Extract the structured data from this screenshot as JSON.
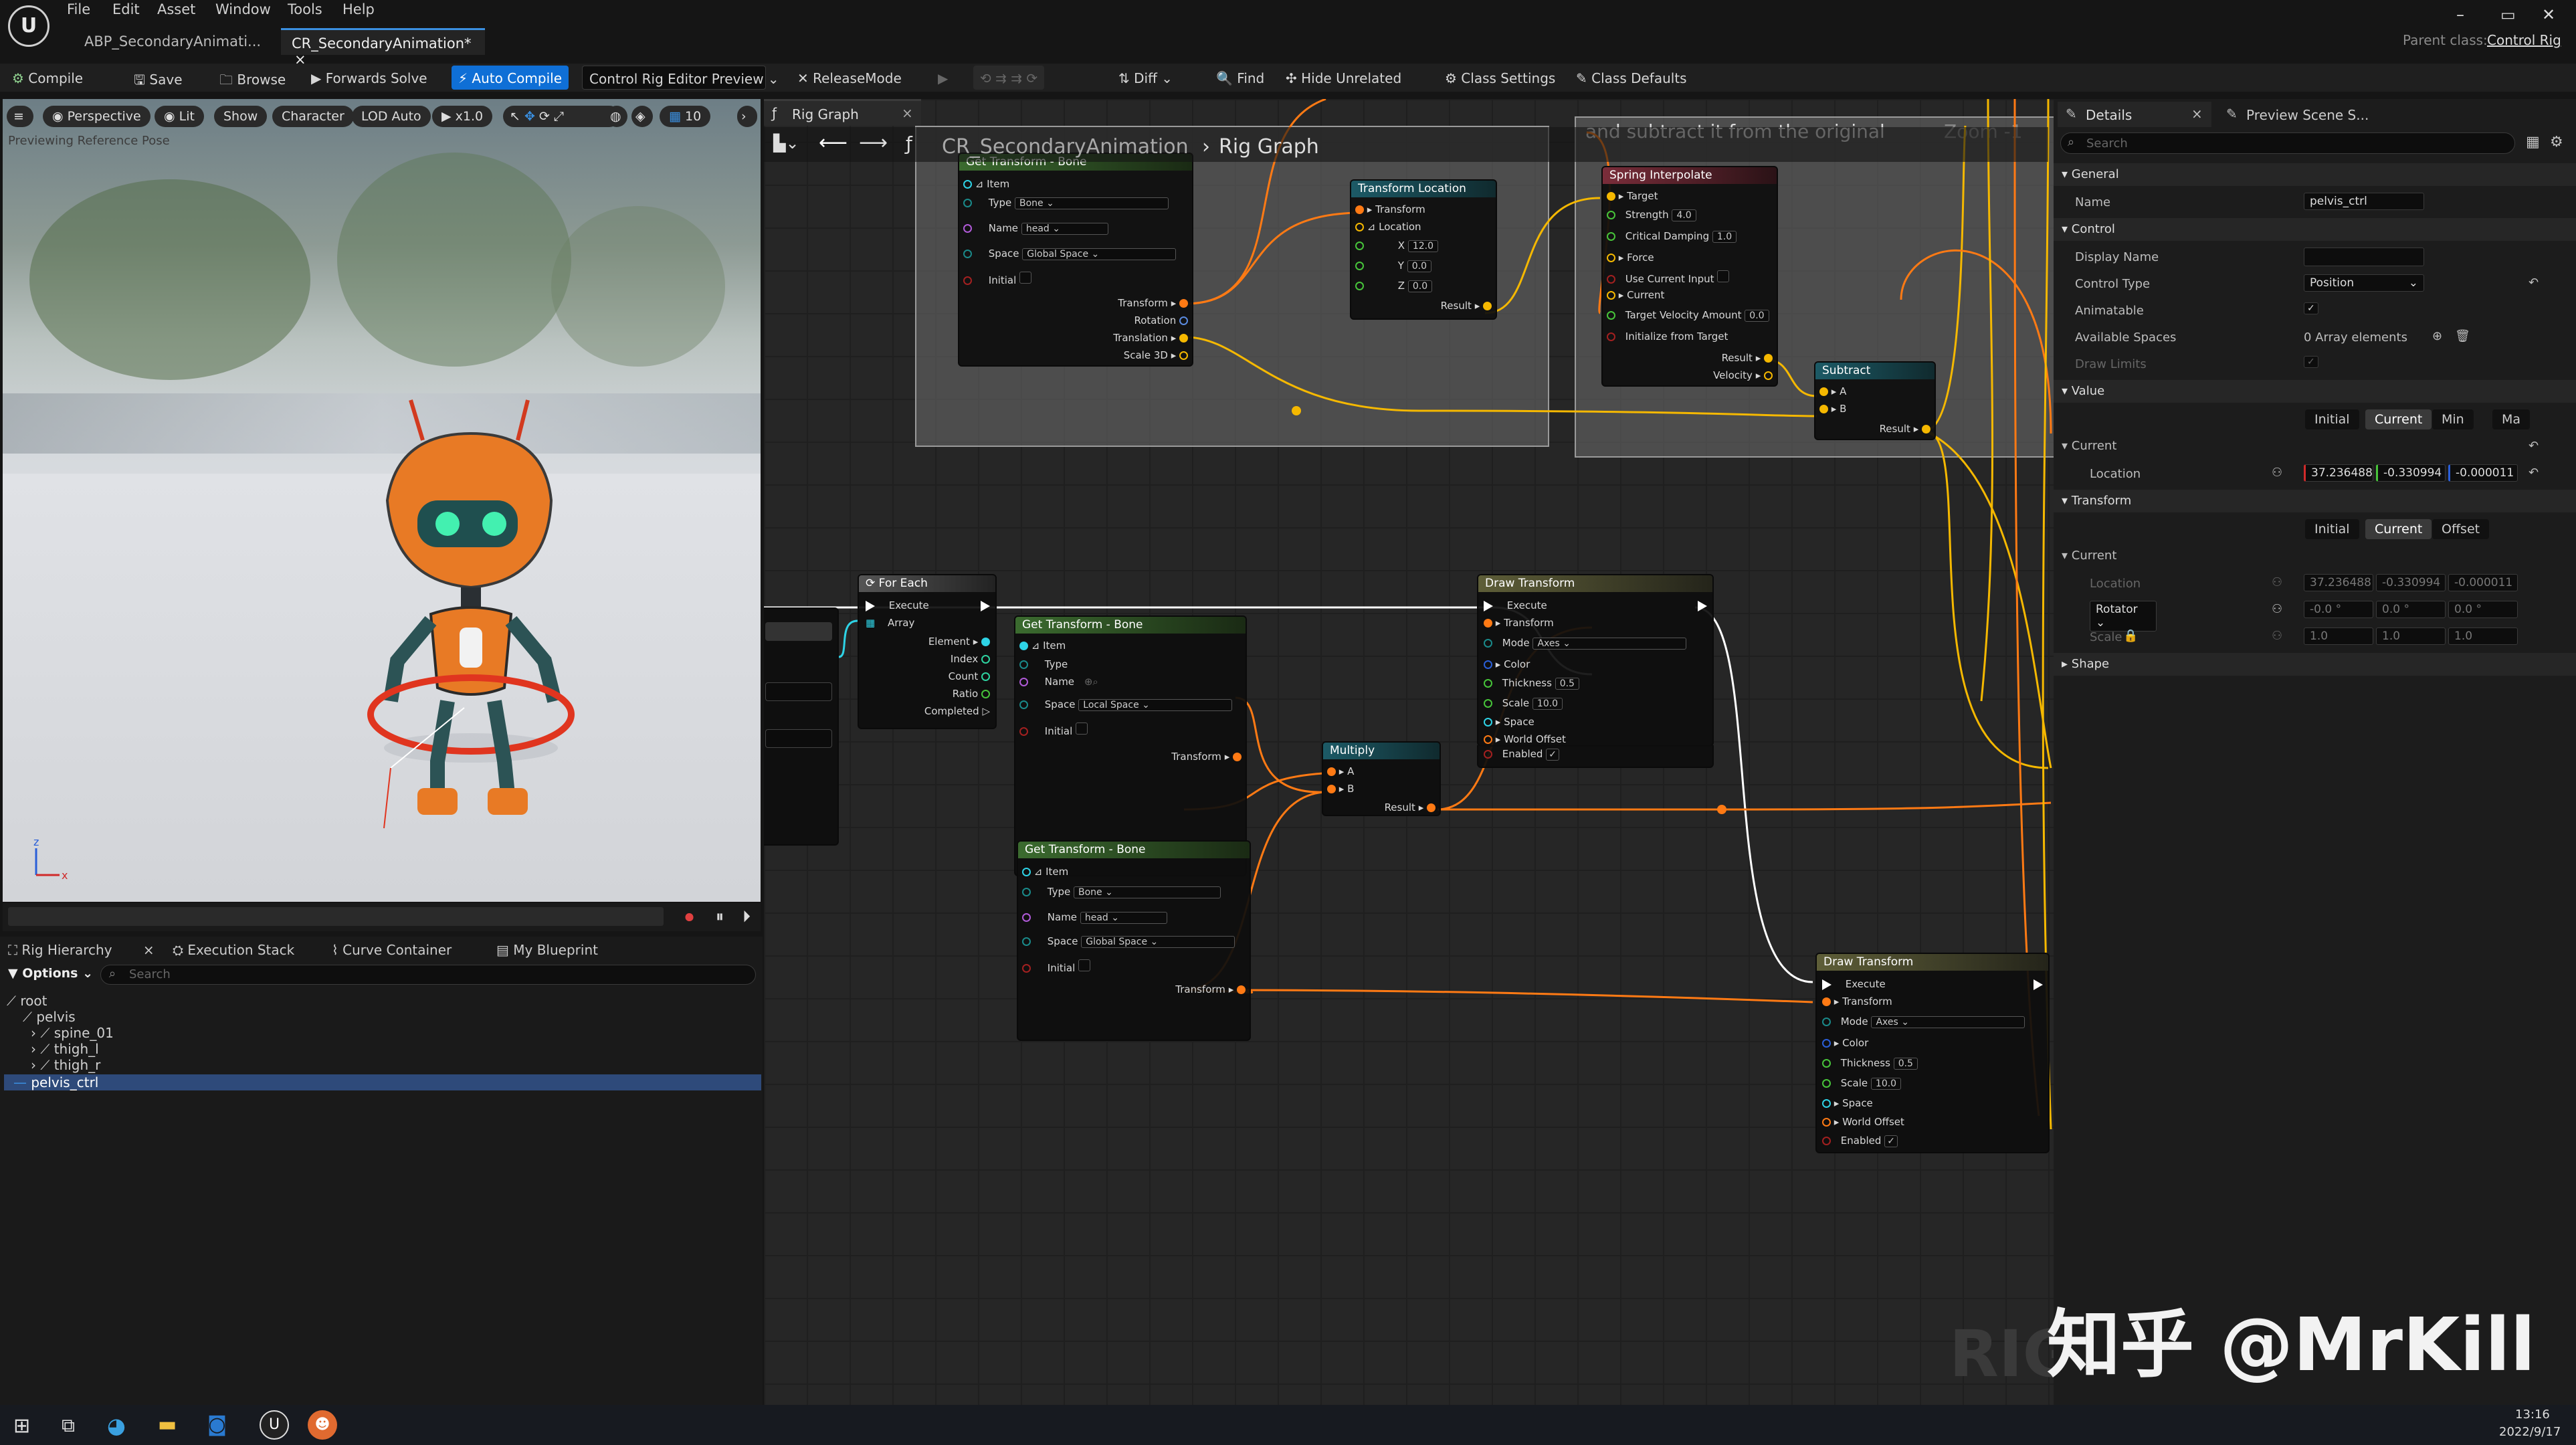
{
  "menu": [
    "File",
    "Edit",
    "Asset",
    "Window",
    "Tools",
    "Help"
  ],
  "tabs": [
    "ABP_SecondaryAnimati...",
    "CR_SecondaryAnimation*"
  ],
  "parent_class": {
    "label": "Parent class:",
    "value": "Control Rig"
  },
  "window_controls": [
    "–",
    "▭",
    "✕"
  ],
  "toolbar": {
    "compile": "Compile",
    "save": "Save",
    "browse": "Browse",
    "forwards_solve": "Forwards Solve",
    "auto_compile": "Auto Compile",
    "preview": "Control Rig Editor Preview",
    "release_mode": "ReleaseMode",
    "diff": "Diff",
    "find": "Find",
    "hide_unrelated": "Hide Unrelated",
    "class_settings": "Class Settings",
    "class_defaults": "Class Defaults"
  },
  "viewport": {
    "perspective": "Perspective",
    "lit": "Lit",
    "show": "Show",
    "character": "Character",
    "lod": "LOD Auto",
    "speed": "x1.0",
    "grid": "10",
    "previewing": "Previewing Reference Pose"
  },
  "bottom_tabs": [
    "Rig Hierarchy",
    "Execution Stack",
    "Curve Container",
    "My Blueprint"
  ],
  "hierarchy": {
    "options": "Options",
    "search_placeholder": "Search",
    "items": [
      "root",
      "pelvis",
      "spine_01",
      "thigh_l",
      "thigh_r",
      "pelvis_ctrl"
    ]
  },
  "graph": {
    "tab": "Rig Graph",
    "breadcrumb_root": "CR_SecondaryAnimation",
    "breadcrumb_leaf": "Rig Graph",
    "comment_text": "and subtract it from the original",
    "zoom": "Zoom -1",
    "watermark": "RIG"
  },
  "nodes": {
    "gt_top": {
      "title": "Get Transform - Bone",
      "item": "Item",
      "type": "Type",
      "type_val": "Bone",
      "name": "Name",
      "name_val": "head",
      "space": "Space",
      "space_val": "Global Space",
      "initial": "Initial",
      "transform": "Transform",
      "rotation": "Rotation",
      "translation": "Translation",
      "scale": "Scale 3D"
    },
    "tl": {
      "title": "Transform Location",
      "transform": "Transform",
      "location": "Location",
      "x": "X",
      "x_val": "12.0",
      "y": "Y",
      "y_val": "0.0",
      "z": "Z",
      "z_val": "0.0",
      "result": "Result"
    },
    "si": {
      "title": "Spring Interpolate",
      "target": "Target",
      "strength": "Strength",
      "strength_val": "4.0",
      "damping": "Critical Damping",
      "damping_val": "1.0",
      "force": "Force",
      "use_current": "Use Current Input",
      "current": "Current",
      "tva": "Target Velocity Amount",
      "tva_val": "0.0",
      "init": "Initialize from Target",
      "result": "Result",
      "velocity": "Velocity"
    },
    "sub": {
      "title": "Subtract",
      "a": "A",
      "b": "B",
      "result": "Result"
    },
    "fe": {
      "title": "For Each",
      "execute": "Execute",
      "array": "Array",
      "element": "Element",
      "index": "Index",
      "count": "Count",
      "ratio": "Ratio",
      "completed": "Completed"
    },
    "gt_mid": {
      "title": "Get Transform - Bone",
      "item": "Item",
      "type": "Type",
      "name": "Name",
      "space": "Space",
      "space_val": "Local Space",
      "initial": "Initial",
      "transform": "Transform"
    },
    "mul": {
      "title": "Multiply",
      "a": "A",
      "b": "B",
      "result": "Result"
    },
    "dt1": {
      "title": "Draw Transform",
      "execute": "Execute",
      "transform": "Transform",
      "mode": "Mode",
      "mode_val": "Axes",
      "color": "Color",
      "thickness": "Thickness",
      "thickness_val": "0.5",
      "scale": "Scale",
      "scale_val": "10.0",
      "space": "Space",
      "world_offset": "World Offset",
      "enabled": "Enabled"
    },
    "gt_bot": {
      "title": "Get Transform - Bone",
      "item": "Item",
      "type": "Type",
      "type_val": "Bone",
      "name": "Name",
      "name_val": "head",
      "space": "Space",
      "space_val": "Global Space",
      "initial": "Initial",
      "transform": "Transform"
    },
    "dt2": {
      "title": "Draw Transform",
      "execute": "Execute",
      "transform": "Transform",
      "mode": "Mode",
      "mode_val": "Axes",
      "color": "Color",
      "thickness": "Thickness",
      "thickness_val": "0.5",
      "scale": "Scale",
      "scale_val": "10.0",
      "space": "Space",
      "world_offset": "World Offset",
      "enabled": "Enabled"
    }
  },
  "details": {
    "tab": "Details",
    "tab2": "Preview Scene S...",
    "search_placeholder": "Search",
    "general": "General",
    "name_label": "Name",
    "name_val": "pelvis_ctrl",
    "control": "Control",
    "display_name": "Display Name",
    "control_type": "Control Type",
    "control_type_val": "Position",
    "animatable": "Animatable",
    "available_spaces": "Available Spaces",
    "available_spaces_val": "0 Array elements",
    "draw_limits": "Draw Limits",
    "value": "Value",
    "value_segs": [
      "Initial",
      "Current",
      "Min",
      "Ma"
    ],
    "current": "Current",
    "location": "Location",
    "loc_x": "37.236488",
    "loc_y": "-0.330994",
    "loc_z": "-0.000011",
    "transform": "Transform",
    "transform_segs": [
      "Initial",
      "Current",
      "Offset"
    ],
    "rotator": "Rotator",
    "rot_x": "-0.0 °",
    "rot_y": "0.0 °",
    "rot_z": "0.0 °",
    "scale": "Scale",
    "scale_x": "1.0",
    "scale_y": "1.0",
    "scale_z": "1.0",
    "shape": "Shape"
  },
  "taskbar": {
    "time": "13:16",
    "date": "2022/9/17"
  },
  "watermark": "知乎 @MrKill",
  "colors": {
    "accent": "#0f6fd6",
    "wire_exec": "#ffffff",
    "wire_vector": "#f5b800",
    "wire_transform": "#ff7a14"
  }
}
